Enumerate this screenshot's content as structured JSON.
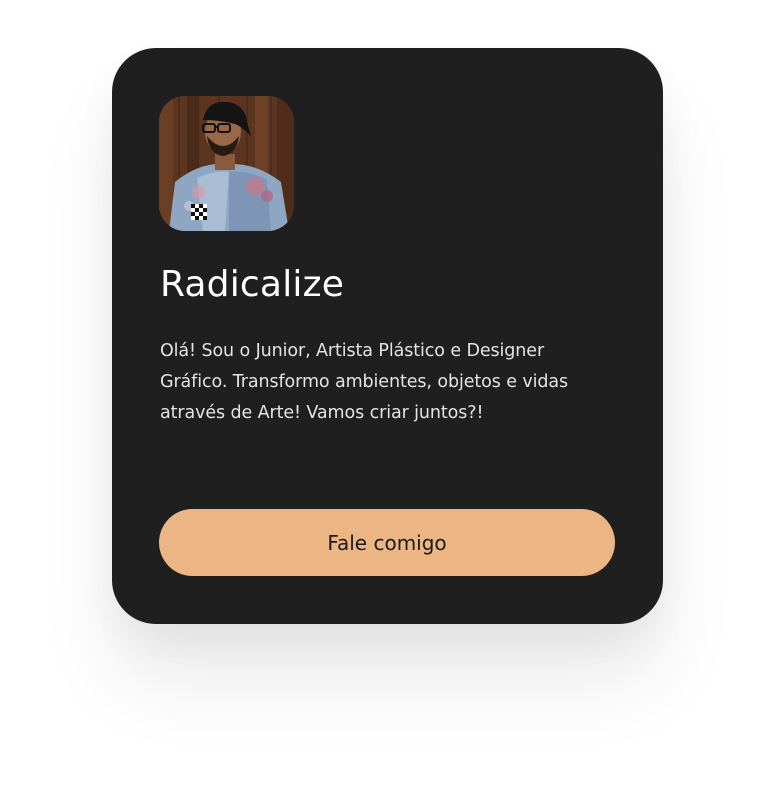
{
  "profile": {
    "name": "Radicalize",
    "bio": "Olá! Sou o Junior, Artista Plástico e Designer Gráfico. Transformo ambientes, objetos e vidas através de Arte! Vamos criar juntos?!",
    "avatar_icon": "profile-photo",
    "cta_label": "Fale comigo"
  },
  "colors": {
    "card_background": "#1f1f1f",
    "cta_background": "#ecb584",
    "title_text": "#ffffff",
    "body_text": "#e4e4e4"
  }
}
